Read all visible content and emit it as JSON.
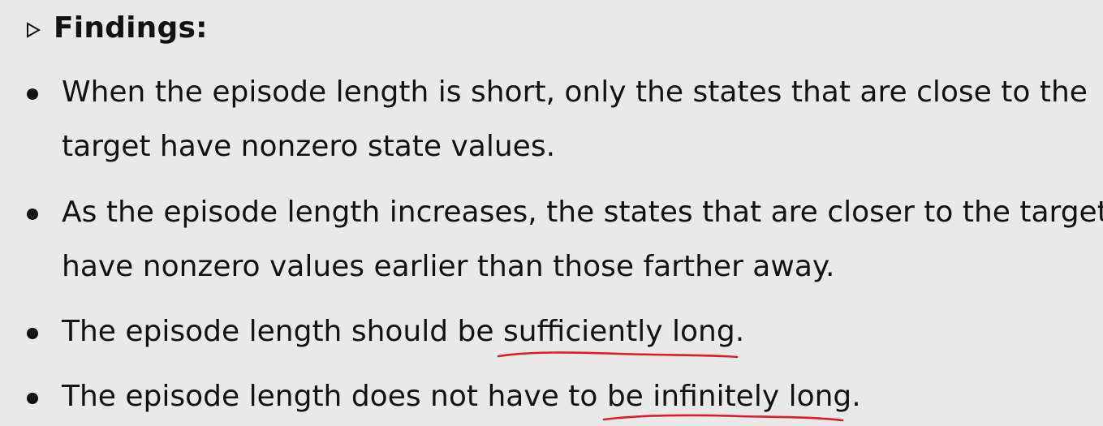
{
  "heading": {
    "marker_icon": "triangle-right-outline-icon",
    "title": "Findings:"
  },
  "bullets": [
    {
      "lines": [
        "When the episode length is short, only the states that are close to the",
        "target have nonzero state values."
      ]
    },
    {
      "lines": [
        "As the episode length increases, the states that are closer to the target",
        "have nonzero values earlier than those farther away."
      ]
    },
    {
      "prefix": "The episode length should be ",
      "underlined": "sufficiently long",
      "suffix": "."
    },
    {
      "prefix": "The episode length does not have to ",
      "underlined": "be infinitely long",
      "suffix": "."
    }
  ],
  "colors": {
    "background": "#e9e9e9",
    "text": "#121212",
    "annotation": "#d81e2c"
  }
}
